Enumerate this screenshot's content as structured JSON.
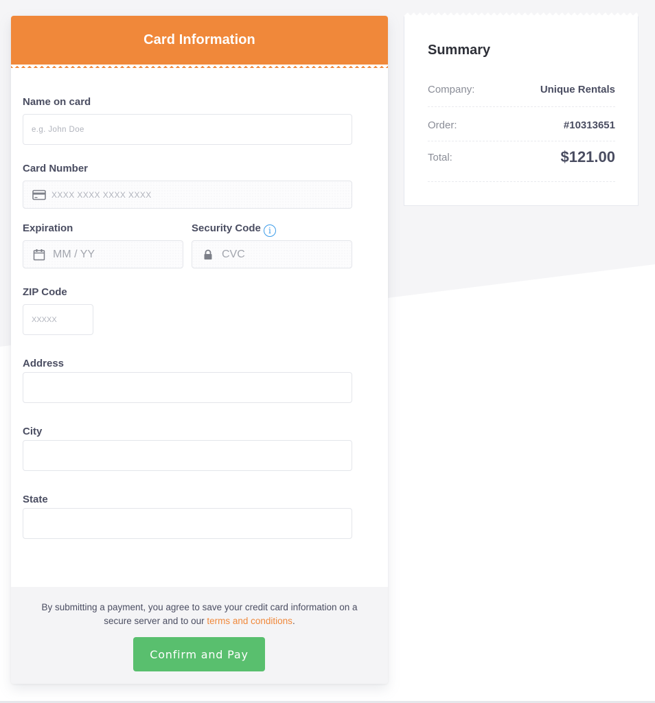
{
  "card": {
    "title": "Card Information",
    "fields": {
      "name": {
        "label": "Name on card",
        "placeholder": "e.g. John Doe",
        "value": ""
      },
      "number": {
        "label": "Card Number",
        "placeholder": "XXXX XXXX XXXX XXXX",
        "value": "",
        "icon": "credit-card-icon"
      },
      "expiration": {
        "label": "Expiration",
        "placeholder": "MM / YY",
        "value": "",
        "icon": "calendar-icon"
      },
      "security": {
        "label": "Security Code",
        "placeholder": "CVC",
        "value": "",
        "icon": "lock-icon",
        "info_icon": "i"
      },
      "zip": {
        "label": "ZIP Code",
        "placeholder": "XXXXX",
        "value": ""
      },
      "address": {
        "label": "Address",
        "placeholder": "",
        "value": ""
      },
      "city": {
        "label": "City",
        "placeholder": "",
        "value": ""
      },
      "state": {
        "label": "State",
        "placeholder": "",
        "value": ""
      }
    },
    "footer": {
      "disclaimer_prefix": "By submitting a payment, you agree to save your credit card information on a secure server and to our ",
      "terms_link": "terms and conditions",
      "disclaimer_suffix": ".",
      "confirm_label": "Confirm and Pay"
    }
  },
  "summary": {
    "title": "Summary",
    "rows": [
      {
        "key": "Company:",
        "value": "Unique Rentals"
      },
      {
        "key": "Order:",
        "value": "#10313651"
      },
      {
        "key": "Total:",
        "value": "$121.00"
      }
    ]
  },
  "colors": {
    "accent_orange": "#f0883a",
    "confirm_green": "#59bf6e",
    "info_blue": "#3a9be8",
    "label_text": "#4a4d61"
  }
}
